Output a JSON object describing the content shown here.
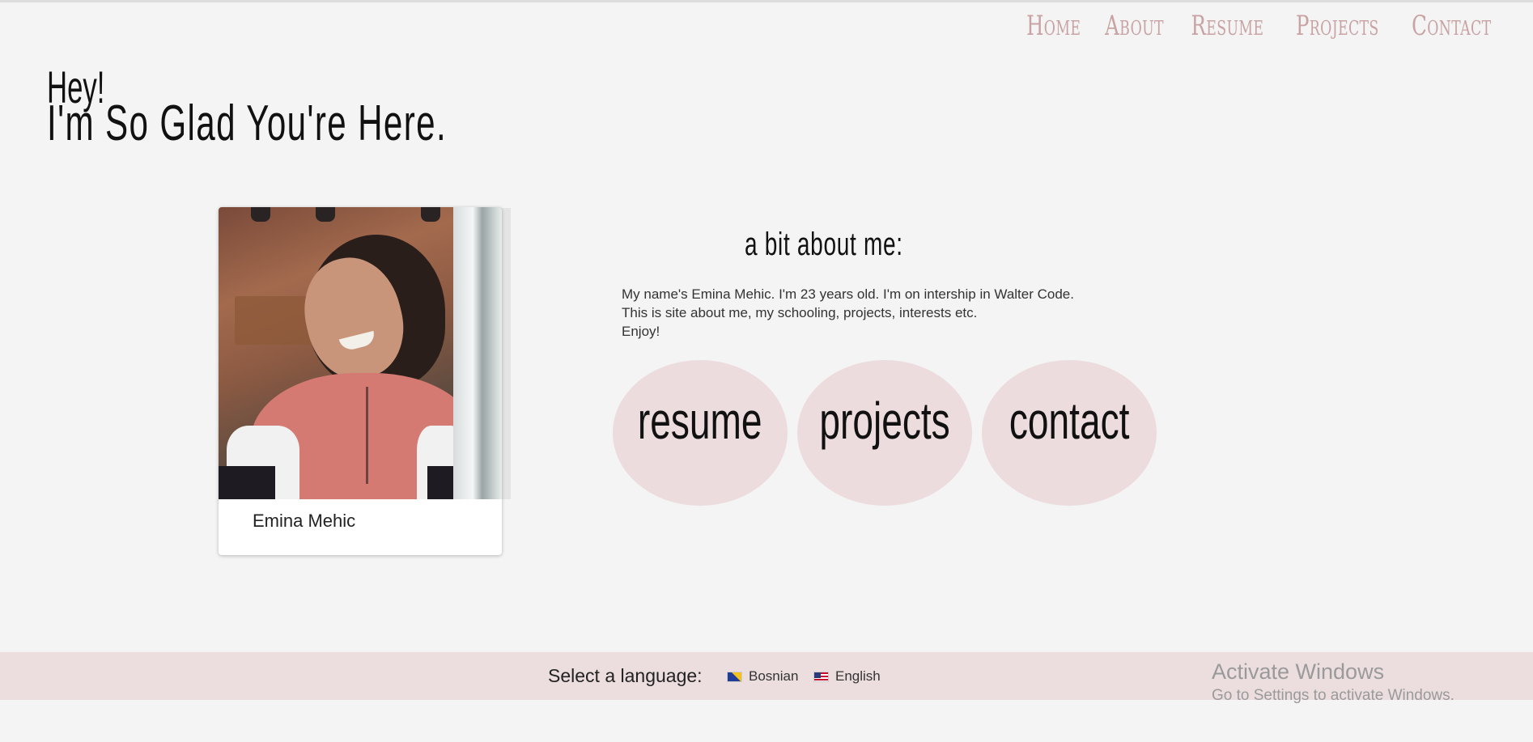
{
  "nav": {
    "items": [
      "Home",
      "About",
      "Resume",
      "Projects",
      "Contact"
    ]
  },
  "hero": {
    "line1": "Hey!",
    "line2": "I'm So Glad You're Here."
  },
  "profile": {
    "name": "Emina Mehic"
  },
  "about": {
    "title": "a bit about me:",
    "lines": [
      "My name's Emina Mehic. I'm 23 years old. I'm on intership in Walter Code.",
      "This is site about me, my schooling, projects, interests etc.",
      "Enjoy!"
    ]
  },
  "links": {
    "resume": "resume",
    "projects": "projects",
    "contact": "contact"
  },
  "footer": {
    "label": "Select a language:",
    "languages": [
      "Bosnian",
      "English"
    ]
  },
  "watermark": {
    "title": "Activate Windows",
    "subtitle": "Go to Settings to activate Windows."
  },
  "colors": {
    "background": "#f4f4f4",
    "nav_text": "#c9a3a3",
    "bubble": "#ecdcdd",
    "footer": "#ecdedf"
  }
}
